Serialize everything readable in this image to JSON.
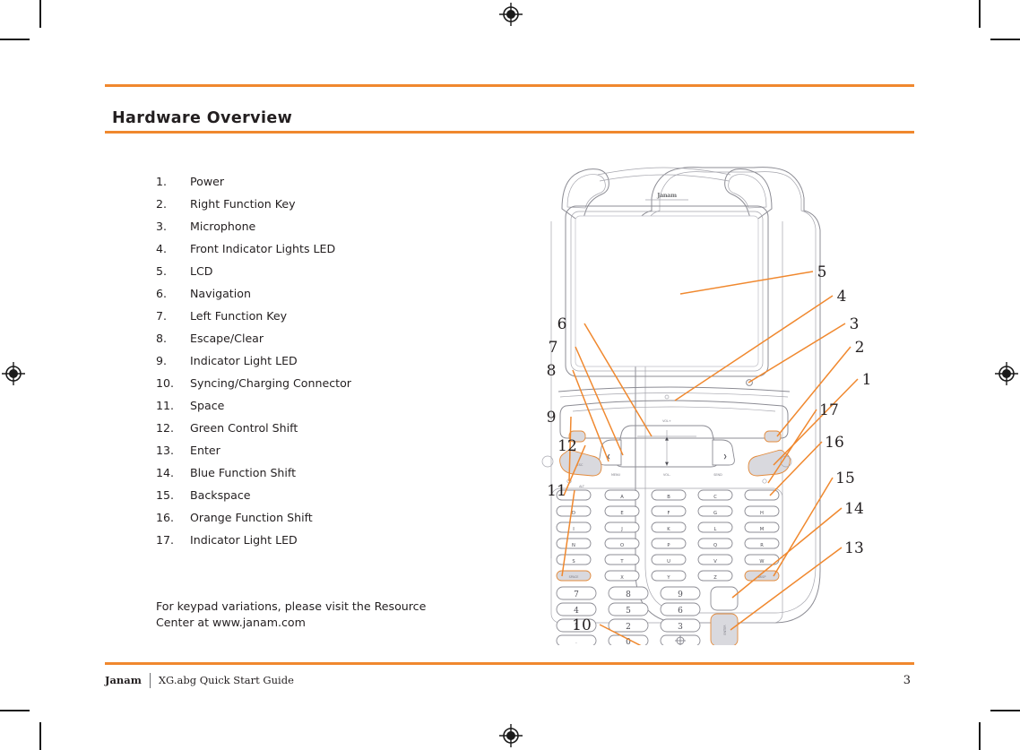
{
  "document": {
    "title": "Hardware Overview",
    "note": "For keypad variations, please visit the Resource Center at www.janam.com"
  },
  "features": [
    {
      "num": "1.",
      "label": "Power"
    },
    {
      "num": "2.",
      "label": "Right Function Key"
    },
    {
      "num": "3.",
      "label": "Microphone"
    },
    {
      "num": "4.",
      "label": "Front Indicator Lights LED"
    },
    {
      "num": "5.",
      "label": "LCD"
    },
    {
      "num": "6.",
      "label": "Navigation"
    },
    {
      "num": "7.",
      "label": "Left Function Key"
    },
    {
      "num": "8.",
      "label": "Escape/Clear"
    },
    {
      "num": "9.",
      "label": "Indicator Light LED"
    },
    {
      "num": "10.",
      "label": "Syncing/Charging Connector"
    },
    {
      "num": "11.",
      "label": "Space"
    },
    {
      "num": "12.",
      "label": "Green Control Shift"
    },
    {
      "num": "13.",
      "label": "Enter"
    },
    {
      "num": "14.",
      "label": "Blue Function Shift"
    },
    {
      "num": "15.",
      "label": "Backspace"
    },
    {
      "num": "16.",
      "label": "Orange Function Shift"
    },
    {
      "num": "17.",
      "label": "Indicator Light LED"
    }
  ],
  "figure": {
    "device_logo": "Janam",
    "callouts_left": [
      "6",
      "7",
      "8",
      "9",
      "12",
      "11",
      "10"
    ],
    "callouts_right": [
      "5",
      "4",
      "3",
      "2",
      "1",
      "17",
      "16",
      "15",
      "14",
      "13"
    ],
    "nav_labels": {
      "up": "VOL+",
      "down": "VOL-",
      "left": "MENU",
      "right": "SEND"
    },
    "keypad_alpha_rows": [
      [
        "A",
        "B",
        "C"
      ],
      [
        "D",
        "E",
        "F",
        "G",
        "H"
      ],
      [
        "I",
        "J",
        "K",
        "L",
        "M"
      ],
      [
        "N",
        "O",
        "P",
        "Q",
        "R"
      ],
      [
        "S",
        "T",
        "U",
        "V",
        "W"
      ],
      [
        "X",
        "Y",
        "Z"
      ]
    ],
    "keypad_numeric_rows": [
      [
        "7",
        "8",
        "9"
      ],
      [
        "4",
        "5",
        "6"
      ],
      [
        "1",
        "2",
        "3"
      ],
      [
        ".",
        "0",
        "scan"
      ]
    ],
    "special_keys": {
      "space": "SPACE",
      "backspace": "BKSP",
      "enter": "ENTER",
      "func": "FUNC",
      "alt": "ALT"
    }
  },
  "footer": {
    "brand": "Janam",
    "doc_title": "XG.abg Quick Start Guide",
    "page_number": "3"
  },
  "colors": {
    "accent_orange": "#f0882e",
    "text": "#231f20",
    "device_line": "#8c8c94"
  }
}
